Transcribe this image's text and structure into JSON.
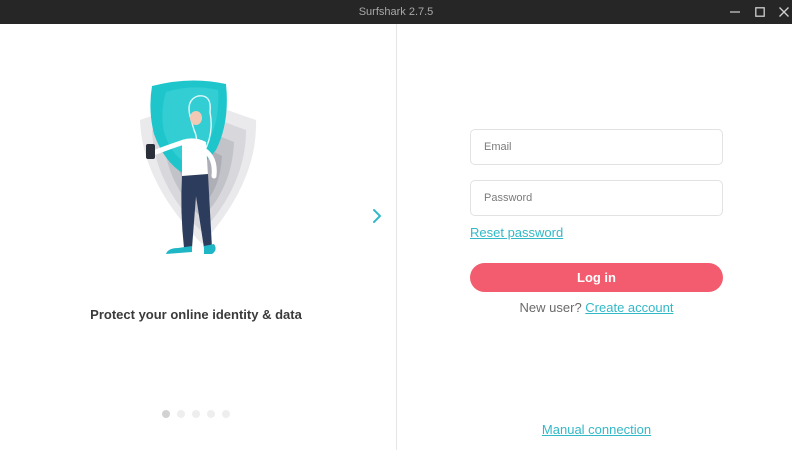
{
  "window": {
    "title": "Surfshark 2.7.5",
    "controls": [
      "minimize-icon",
      "maximize-icon",
      "close-icon"
    ]
  },
  "onboarding": {
    "caption": "Protect your online identity & data",
    "illustration": "shield-person-illustration",
    "next_icon": "chevron-right-icon",
    "slides_total": 5,
    "active_slide": 1
  },
  "login": {
    "email_placeholder": "Email",
    "password_placeholder": "Password",
    "reset_password": "Reset password",
    "login_button": "Log in",
    "new_user_text": "New user?",
    "create_account": "Create account",
    "manual_connection": "Manual connection"
  },
  "colors": {
    "accent_teal": "#33b8c7",
    "login_button": "#f25c6e",
    "titlebar": "#262626"
  }
}
